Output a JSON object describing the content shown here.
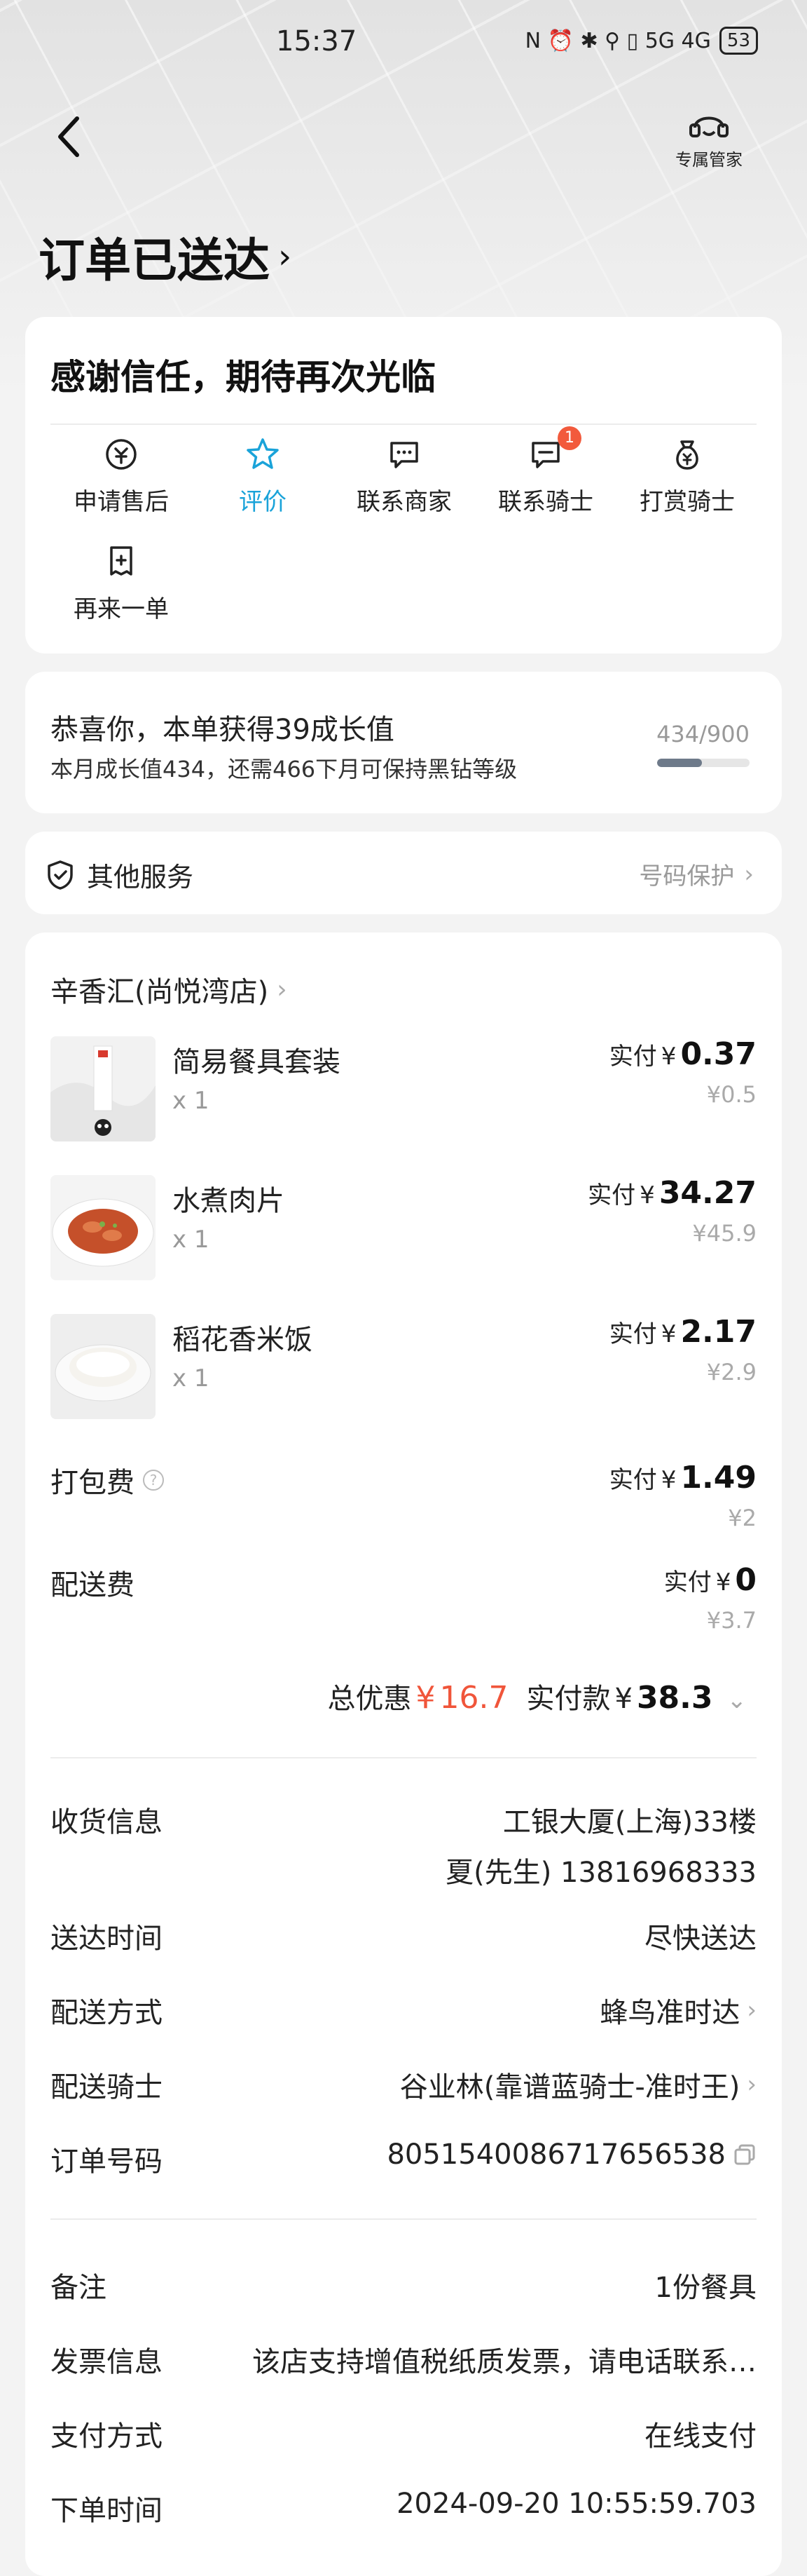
{
  "status_bar": {
    "time": "15:37",
    "icons_text": "N ⏰ ✱ ⚲ ▯ 5G 4G",
    "battery": "53"
  },
  "header": {
    "butler_label": "专属管家",
    "title": "订单已送达"
  },
  "actions_card": {
    "thanks": "感谢信任，期待再次光临",
    "actions": [
      {
        "label": "申请售后",
        "icon": "after-sale-icon"
      },
      {
        "label": "评价",
        "icon": "star-icon"
      },
      {
        "label": "联系商家",
        "icon": "chat-icon"
      },
      {
        "label": "联系骑士",
        "icon": "rider-chat-icon",
        "badge": "1"
      },
      {
        "label": "打赏骑士",
        "icon": "tip-bag-icon"
      },
      {
        "label": "再来一单",
        "icon": "reorder-icon"
      }
    ],
    "active_color": "#1aa3d9"
  },
  "growth": {
    "title": "恭喜你，本单获得39成长值",
    "subtitle": "本月成长值434，还需466下月可保持黑钻等级",
    "count": "434/900",
    "progress": 0.482
  },
  "services": {
    "label": "其他服务",
    "right": "号码保护"
  },
  "order": {
    "shop": "辛香汇(尚悦湾店)",
    "pay_prefix": "实付",
    "currency": "¥",
    "items": [
      {
        "name": "简易餐具套装",
        "qty": "x 1",
        "paid": "0.37",
        "original": "¥0.5"
      },
      {
        "name": "水煮肉片",
        "qty": "x 1",
        "paid": "34.27",
        "original": "¥45.9"
      },
      {
        "name": "稻花香米饭",
        "qty": "x 1",
        "paid": "2.17",
        "original": "¥2.9"
      }
    ],
    "packing_fee": {
      "label": "打包费",
      "paid": "1.49",
      "original": "¥2"
    },
    "delivery_fee": {
      "label": "配送费",
      "paid": "0",
      "original": "¥3.7"
    },
    "total_discount_label": "总优惠",
    "total_discount": "16.7",
    "total_paid_label": "实付款",
    "total_paid": "38.3",
    "discount_color": "#f0553a"
  },
  "delivery_info": {
    "address_label": "收货信息",
    "address": "工银大厦(上海)33楼",
    "contact": "夏(先生) 13816968333",
    "time_label": "送达时间",
    "time": "尽快送达",
    "method_label": "配送方式",
    "method": "蜂鸟准时达",
    "rider_label": "配送骑士",
    "rider": "谷业林(靠谱蓝骑士-准时王)",
    "order_no_label": "订单号码",
    "order_no": "8051540086717656538"
  },
  "extra_info": {
    "note_label": "备注",
    "note": "1份餐具",
    "invoice_label": "发票信息",
    "invoice": "该店支持增值税纸质发票，请电话联系…",
    "payment_label": "支付方式",
    "payment": "在线支付",
    "order_time_label": "下单时间",
    "order_time": "2024-09-20 10:55:59.703"
  }
}
